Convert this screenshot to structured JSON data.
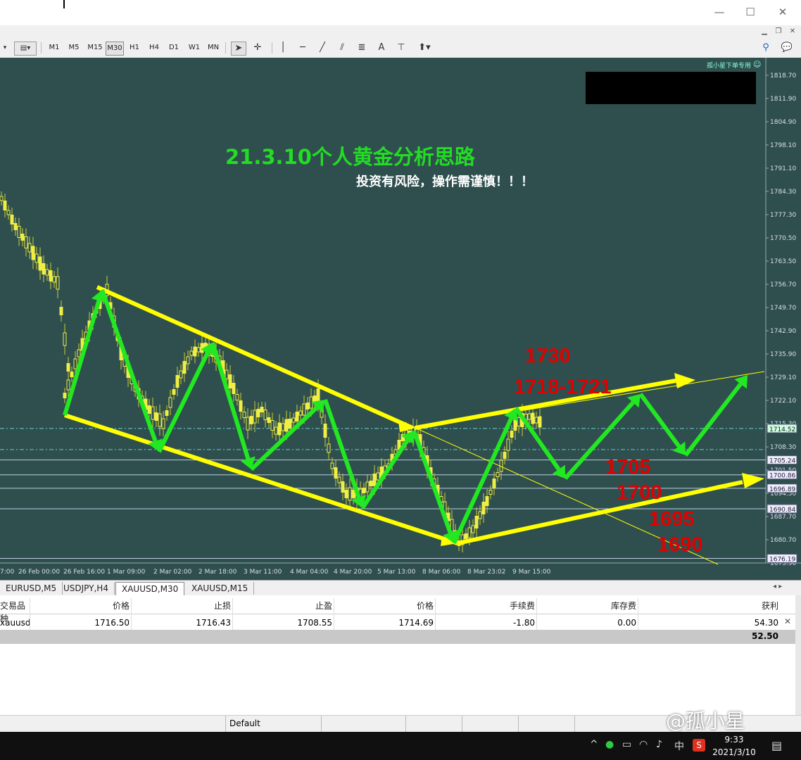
{
  "window": {
    "minimize": "—",
    "maximize": "☐",
    "close": "✕"
  },
  "toolbar": {
    "timeframes": [
      "M1",
      "M5",
      "M15",
      "M30",
      "H1",
      "H4",
      "D1",
      "W1",
      "MN"
    ],
    "selected_timeframe": "M30",
    "tools": [
      "A"
    ]
  },
  "chart": {
    "indicator_label": "孤小星下单专用",
    "title": "21.3.10个人黄金分析思路",
    "subtitle": "投资有风险，操作需谨慎！！！",
    "price_axis": [
      "1818.70",
      "1811.90",
      "1804.90",
      "1798.10",
      "1791.10",
      "1784.30",
      "1777.30",
      "1770.50",
      "1763.50",
      "1756.70",
      "1749.70",
      "1742.90",
      "1735.90",
      "1729.10",
      "1722.10",
      "1715.30",
      "1708.30",
      "1701.50",
      "1694.50",
      "1687.70",
      "1680.70",
      "1673.90"
    ],
    "price_tags": [
      "1714.52",
      "1705.24",
      "1700.86",
      "1696.89",
      "1690.84",
      "1676.19"
    ],
    "time_axis": [
      "7:00",
      "26 Feb 00:00",
      "26 Feb 16:00",
      "1 Mar 09:00",
      "2 Mar 02:00",
      "2 Mar 18:00",
      "3 Mar 11:00",
      "4 Mar 04:00",
      "4 Mar 20:00",
      "5 Mar 13:00",
      "8 Mar 06:00",
      "8 Mar 23:02",
      "9 Mar 15:00"
    ],
    "annotations": [
      "1730",
      "1718-1721",
      "1705",
      "1700",
      "1695",
      "1690"
    ],
    "colors": {
      "background": "#2f4f4f",
      "arrow_green": "#22e822",
      "channel_yellow": "#ffff00",
      "annotation_red": "#e00000",
      "title_green": "#22dd22"
    }
  },
  "tabs": [
    "EURUSD,M5",
    "USDJPY,H4",
    "XAUUSD,M30",
    "XAUUSD,M15"
  ],
  "active_tab": "XAUUSD,M30",
  "terminal": {
    "headers": [
      "交易品种",
      "价格",
      "止损",
      "止盈",
      "价格",
      "手续费",
      "库存费",
      "获利"
    ],
    "row": [
      "xauusd",
      "1716.50",
      "1716.43",
      "1708.55",
      "1714.69",
      "-1.80",
      "0.00",
      "54.30"
    ],
    "total": "52.50"
  },
  "status": {
    "profile": "Default"
  },
  "watermark": "@孤小星",
  "taskbar": {
    "time": "9:33",
    "date": "2021/3/10",
    "ime": "中"
  }
}
